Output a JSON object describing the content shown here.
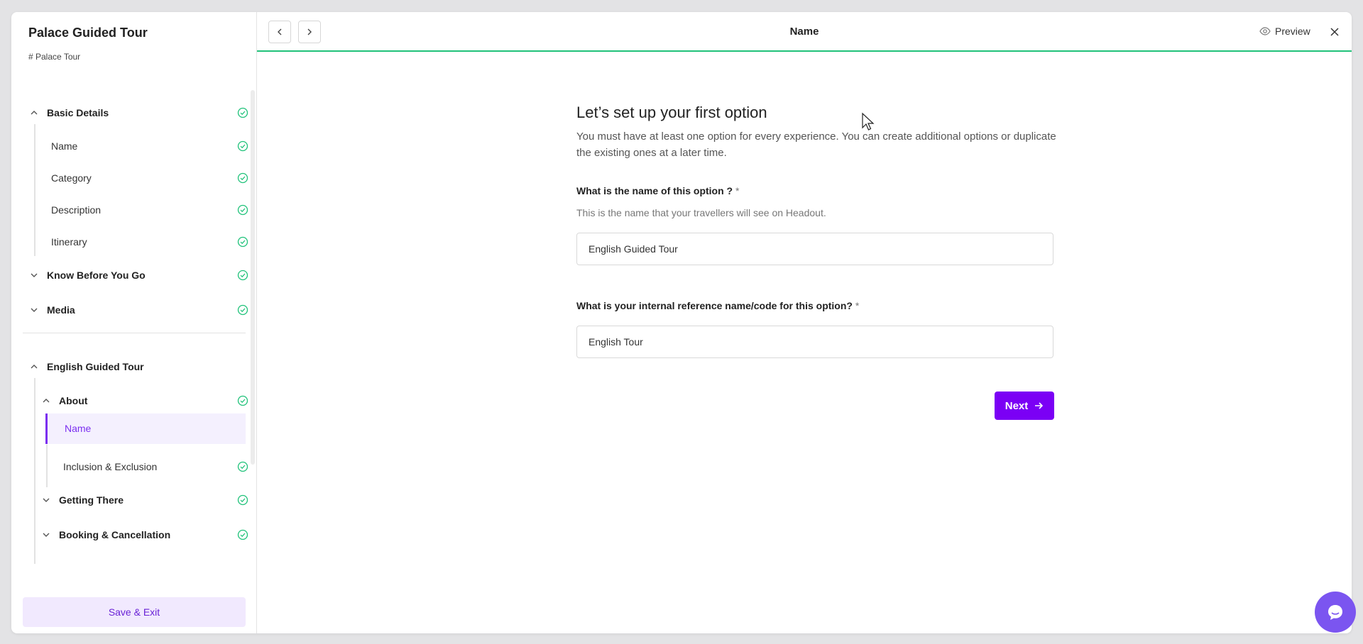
{
  "sidebar": {
    "title": "Palace Guided Tour",
    "subtitle": "# Palace Tour",
    "sections": {
      "basic_details": "Basic Details",
      "name": "Name",
      "category": "Category",
      "description": "Description",
      "itinerary": "Itinerary",
      "know_before": "Know Before You Go",
      "media": "Media",
      "option": "English Guided Tour",
      "about": "About",
      "about_name": "Name",
      "inclusion": "Inclusion & Exclusion",
      "getting_there": "Getting There",
      "booking": "Booking & Cancellation"
    },
    "save_label": "Save & Exit"
  },
  "topbar": {
    "title": "Name",
    "preview_label": "Preview"
  },
  "main": {
    "heading": "Let’s set up your first option",
    "description": "You must have at least one option for every experience. You can create additional options or duplicate the existing ones at a later time.",
    "q1_label": "What is the name of this option ?",
    "q1_hint": "This is the name that your travellers will see on Headout.",
    "q1_value": "English Guided Tour",
    "q2_label": "What is your internal reference name/code for this option?",
    "q2_value": "English Tour",
    "required_mark": "*",
    "next_label": "Next"
  },
  "colors": {
    "accent": "#7b00f5",
    "success": "#20c27a",
    "selected_bg": "#f4f0fe"
  },
  "icons": [
    "chevron-up-icon",
    "chevron-down-icon",
    "check-circle-icon",
    "chevron-left-icon",
    "chevron-right-icon",
    "eye-icon",
    "close-icon",
    "arrow-right-icon",
    "chat-icon"
  ]
}
